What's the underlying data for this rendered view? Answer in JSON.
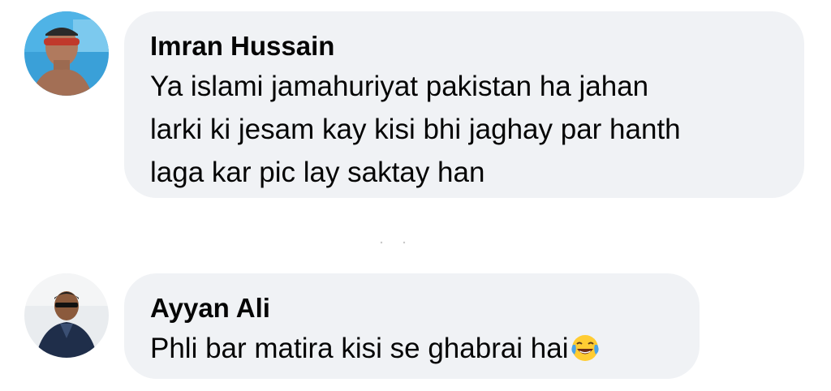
{
  "comments": [
    {
      "author": "Imran Hussain",
      "text": "Ya islami jamahuriyat pakistan ha jahan\nlarki ki jesam kay kisi bhi jaghay par hanth\nlaga kar pic lay saktay han"
    },
    {
      "author": "Ayyan Ali",
      "text": "Phli bar matira kisi se ghabrai hai",
      "emoji": "face-with-tears-of-joy"
    }
  ],
  "colors": {
    "bubble": "#f0f2f5",
    "text": "#050505"
  }
}
